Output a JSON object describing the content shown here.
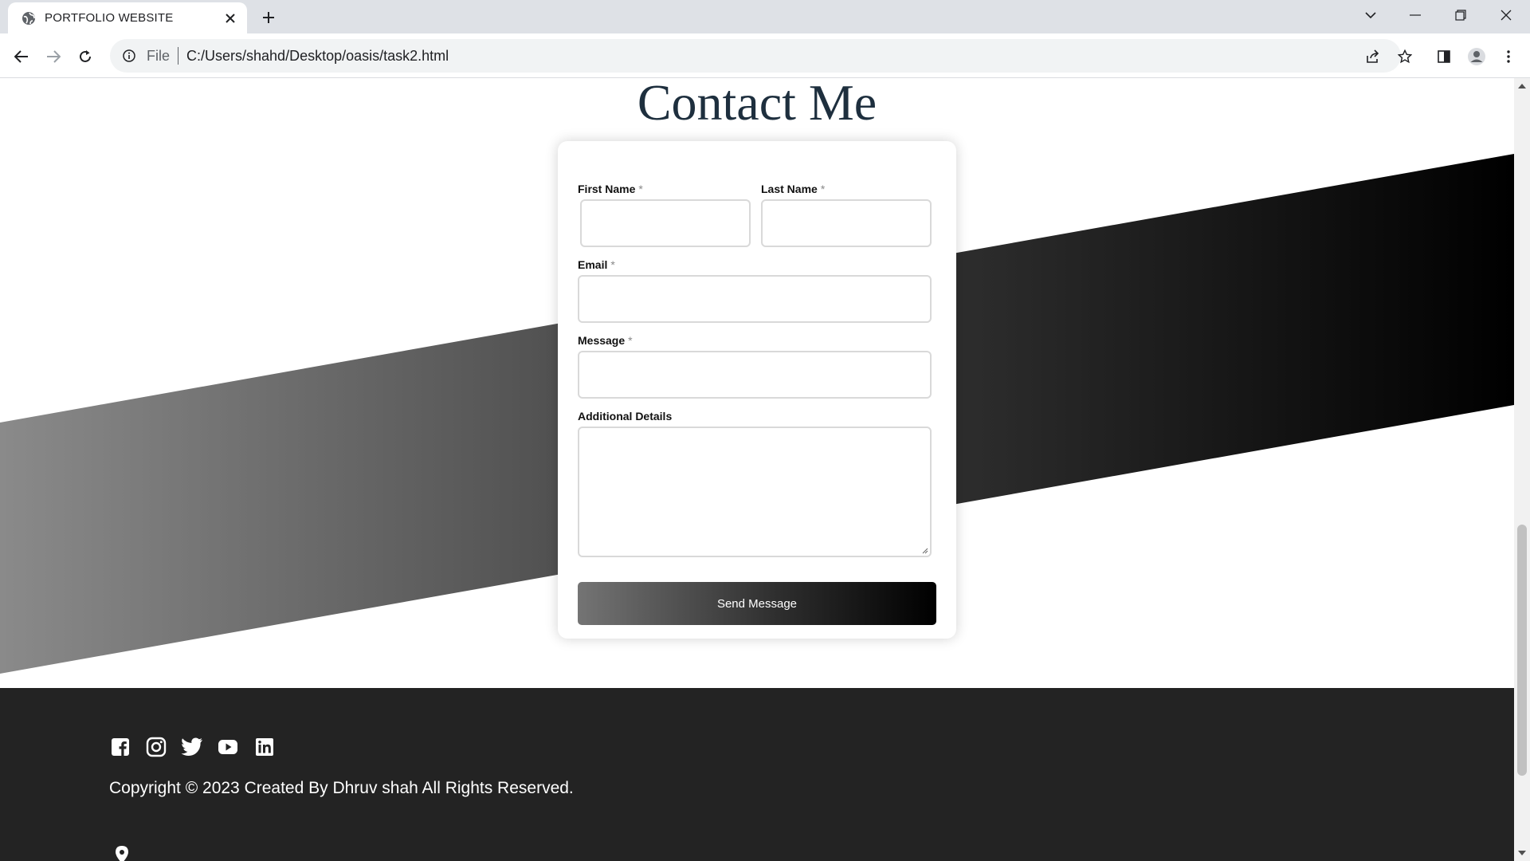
{
  "browser": {
    "tab_title": "PORTFOLIO WEBSITE",
    "scheme_label": "File",
    "url": "C:/Users/shahd/Desktop/oasis/task2.html"
  },
  "page": {
    "title": "Contact Me",
    "form": {
      "first_name_label": "First Name",
      "last_name_label": "Last Name",
      "email_label": "Email",
      "message_label": "Message",
      "additional_label": "Additional Details",
      "required_marker": "*",
      "submit_label": "Send Message"
    },
    "footer": {
      "social_icons": [
        "facebook-icon",
        "instagram-icon",
        "twitter-icon",
        "youtube-icon",
        "linkedin-icon"
      ],
      "copyright": "Copyright © 2023 Created By Dhruv shah All Rights Reserved."
    }
  },
  "colors": {
    "title": "#1e2f3e",
    "footer_bg": "#232323",
    "band_light": "#8a8a8a",
    "band_dark": "#000000"
  }
}
